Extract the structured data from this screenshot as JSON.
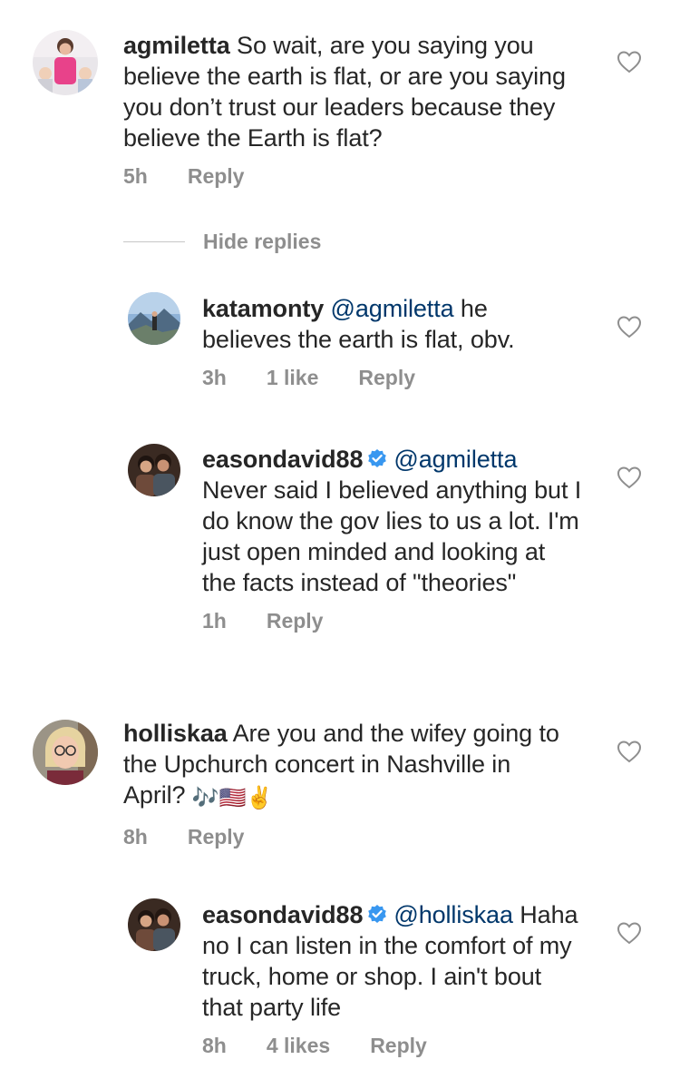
{
  "comments": [
    {
      "username": "agmiletta",
      "text": "So wait, are you saying you believe the earth is flat, or are you saying you don’t trust our leaders because they believe the Earth is flat?",
      "time": "5h",
      "reply_label": "Reply"
    },
    {
      "username": "katamonty",
      "mention": "@agmiletta",
      "text": "he believes the earth is flat, obv.",
      "time": "3h",
      "likes": "1 like",
      "reply_label": "Reply"
    },
    {
      "username": "easondavid88",
      "mention": "@agmiletta",
      "text": "Never said I believed anything but I do know the gov lies to us a lot. I'm just open minded and looking at the facts instead of \"theories\"",
      "time": "1h",
      "reply_label": "Reply"
    },
    {
      "username": "holliskaa",
      "text": "Are you and the wifey going to the Upchurch concert in Nashville in April?",
      "emoji": "🎶🇺🇸✌️",
      "time": "8h",
      "reply_label": "Reply"
    },
    {
      "username": "easondavid88",
      "mention": "@holliskaa",
      "text": "Haha no I can listen in the comfort of my truck, home or shop. I ain't bout that party life",
      "time": "8h",
      "likes": "4 likes",
      "reply_label": "Reply"
    }
  ],
  "hide_replies_label": "Hide replies",
  "colors": {
    "text": "#262626",
    "meta": "#8e8e8e",
    "mention": "#00376b",
    "verified": "#3897f0"
  },
  "icons": {
    "like": "heart-outline-icon",
    "verified": "verified-badge-icon"
  }
}
